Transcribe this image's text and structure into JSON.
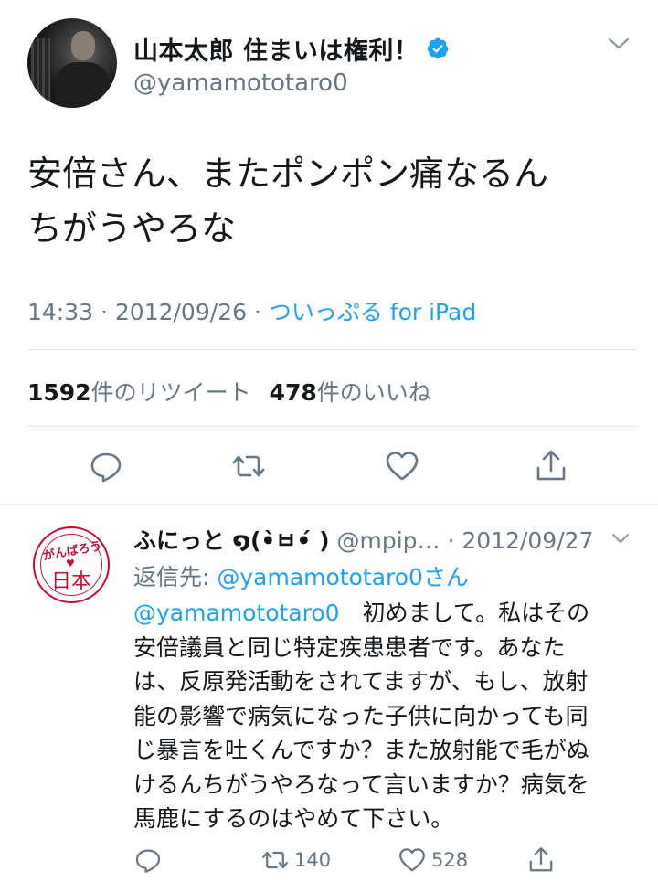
{
  "tweet": {
    "display_name": "山本太郎 住まいは権利！",
    "handle": "@yamamototaro0",
    "text_lines": [
      "安倍さん、またポンポン痛なるん",
      "ちがうやろな"
    ],
    "time": "14:33 · 2012/09/26 · ",
    "client": "ついっぷる for iPad",
    "retweet_count": "1592",
    "retweet_label": "件のリツイート",
    "like_count": "478",
    "like_label": "件のいいね",
    "icons": [
      "verified-badge-icon",
      "chevron-down-icon",
      "reply-icon",
      "retweet-icon",
      "like-icon",
      "share-icon"
    ]
  },
  "reply": {
    "display_name": "ふにっと ໑(•̀ㅂ•́ )",
    "handle": "@mpip…",
    "date": " · 2012/09/27",
    "reply_to_label": "返信先: ",
    "reply_to_mention": "@yamamototaro0さん",
    "mention": "@yamamototaro0",
    "text_lines": [
      "　初めまして。私はその",
      "安倍議員と同じ特定疾患患者です。あなた",
      "は、反原発活動をされてますが、もし、放射",
      "能の影響で病気になった子供に向かっても同",
      "じ暴言を吐くんですか？また放射能で毛がぬ",
      "けるんちがうやろなって言いますか？病気を",
      "馬鹿にするのはやめて下さい。"
    ],
    "avatar_text_top": "がんばろう",
    "avatar_text_bottom": "日本",
    "retweet_count": "140",
    "like_count": "528"
  },
  "colors": {
    "accent": "#1da1f2",
    "text": "#14171a",
    "secondary": "#657786",
    "divider": "#e1e8ed",
    "stamp_red": "#c8102e"
  }
}
